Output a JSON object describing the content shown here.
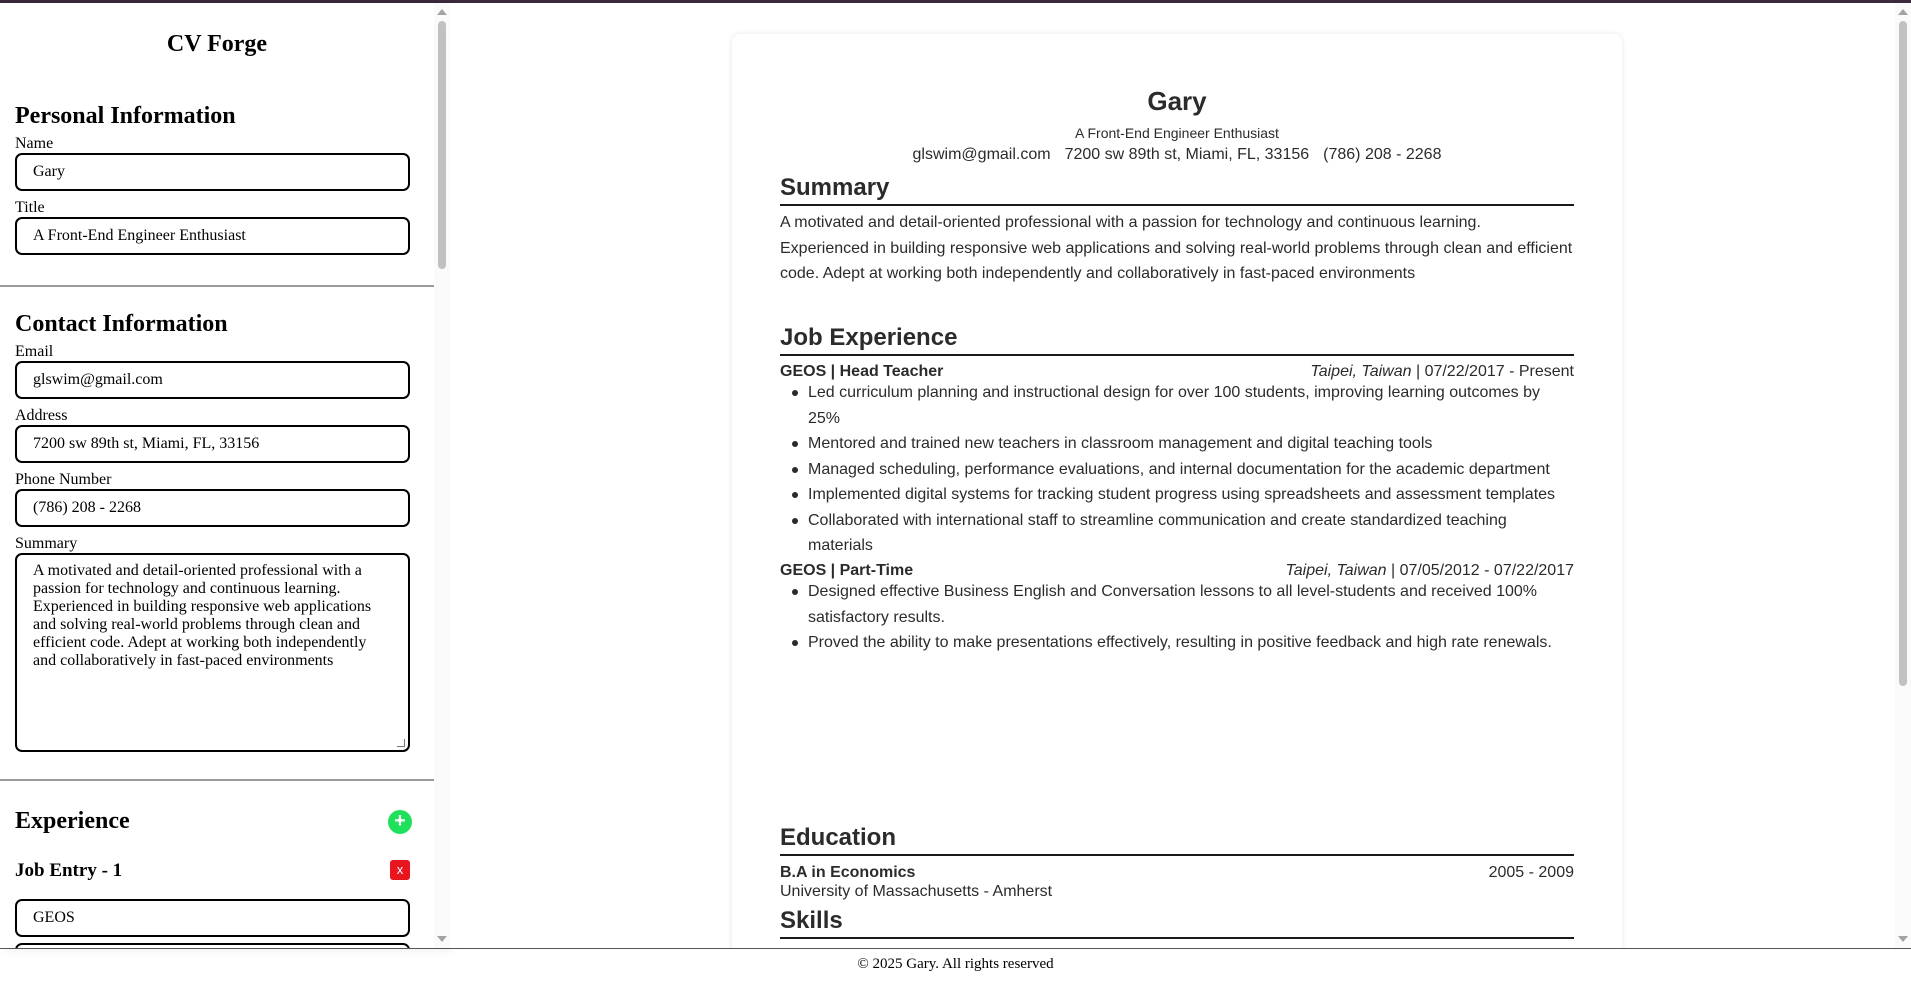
{
  "app": {
    "title": "CV Forge"
  },
  "sidebar": {
    "personal": {
      "heading": "Personal Information",
      "name_label": "Name",
      "name_value": "Gary",
      "title_label": "Title",
      "title_value": "A Front-End Engineer Enthusiast"
    },
    "contact": {
      "heading": "Contact Information",
      "email_label": "Email",
      "email_value": "glswim@gmail.com",
      "address_label": "Address",
      "address_value": "7200 sw 89th st, Miami, FL, 33156",
      "phone_label": "Phone Number",
      "phone_value": "(786) 208 - 2268",
      "summary_label": "Summary",
      "summary_value": "A motivated and detail-oriented professional with a passion for technology and continuous learning. Experienced in building responsive web applications and solving real-world problems through clean and efficient code. Adept at working both independently and collaboratively in fast-paced environments"
    },
    "experience": {
      "heading": "Experience",
      "add_label": "+",
      "entry_heading": "Job Entry - 1",
      "delete_label": "x",
      "company_value": "GEOS"
    }
  },
  "resume": {
    "name": "Gary",
    "title": "A Front-End Engineer Enthusiast",
    "contact": {
      "email": "glswim@gmail.com",
      "address": "7200 sw 89th st, Miami, FL, 33156",
      "phone": "(786) 208 - 2268"
    },
    "summary_heading": "Summary",
    "summary_text": "A motivated and detail-oriented professional with a passion for technology and continuous learning. Experienced in building responsive web applications and solving real-world problems through clean and efficient code. Adept at working both independently and collaboratively in fast-paced environments",
    "experience_heading": "Job Experience",
    "jobs": [
      {
        "company": "GEOS",
        "separator": " | ",
        "role": "Head Teacher",
        "location": "Taipei, Taiwan",
        "dates": " | 07/22/2017 - Present",
        "bullets": [
          "Led curriculum planning and instructional design for over 100 students, improving learning outcomes by 25%",
          "Mentored and trained new teachers in classroom management and digital teaching tools",
          "Managed scheduling, performance evaluations, and internal documentation for the academic department",
          "Implemented digital systems for tracking student progress using spreadsheets and assessment templates",
          "Collaborated with international staff to streamline communication and create standardized teaching materials"
        ]
      },
      {
        "company": "GEOS",
        "separator": " | ",
        "role": "Part-Time",
        "location": "Taipei, Taiwan",
        "dates": " | 07/05/2012 - 07/22/2017",
        "bullets": [
          "Designed effective Business English and Conversation lessons to all level-students and received 100% satisfactory results.",
          "Proved the ability to make presentations effectively, resulting in positive feedback and high rate renewals."
        ]
      }
    ],
    "education_heading": "Education",
    "education": {
      "degree": "B.A in Economics",
      "years": "2005 - 2009",
      "school": "University of Massachusetts - Amherst"
    },
    "skills_heading": "Skills"
  },
  "footer": {
    "text": "© 2025 Gary. All rights reserved"
  }
}
